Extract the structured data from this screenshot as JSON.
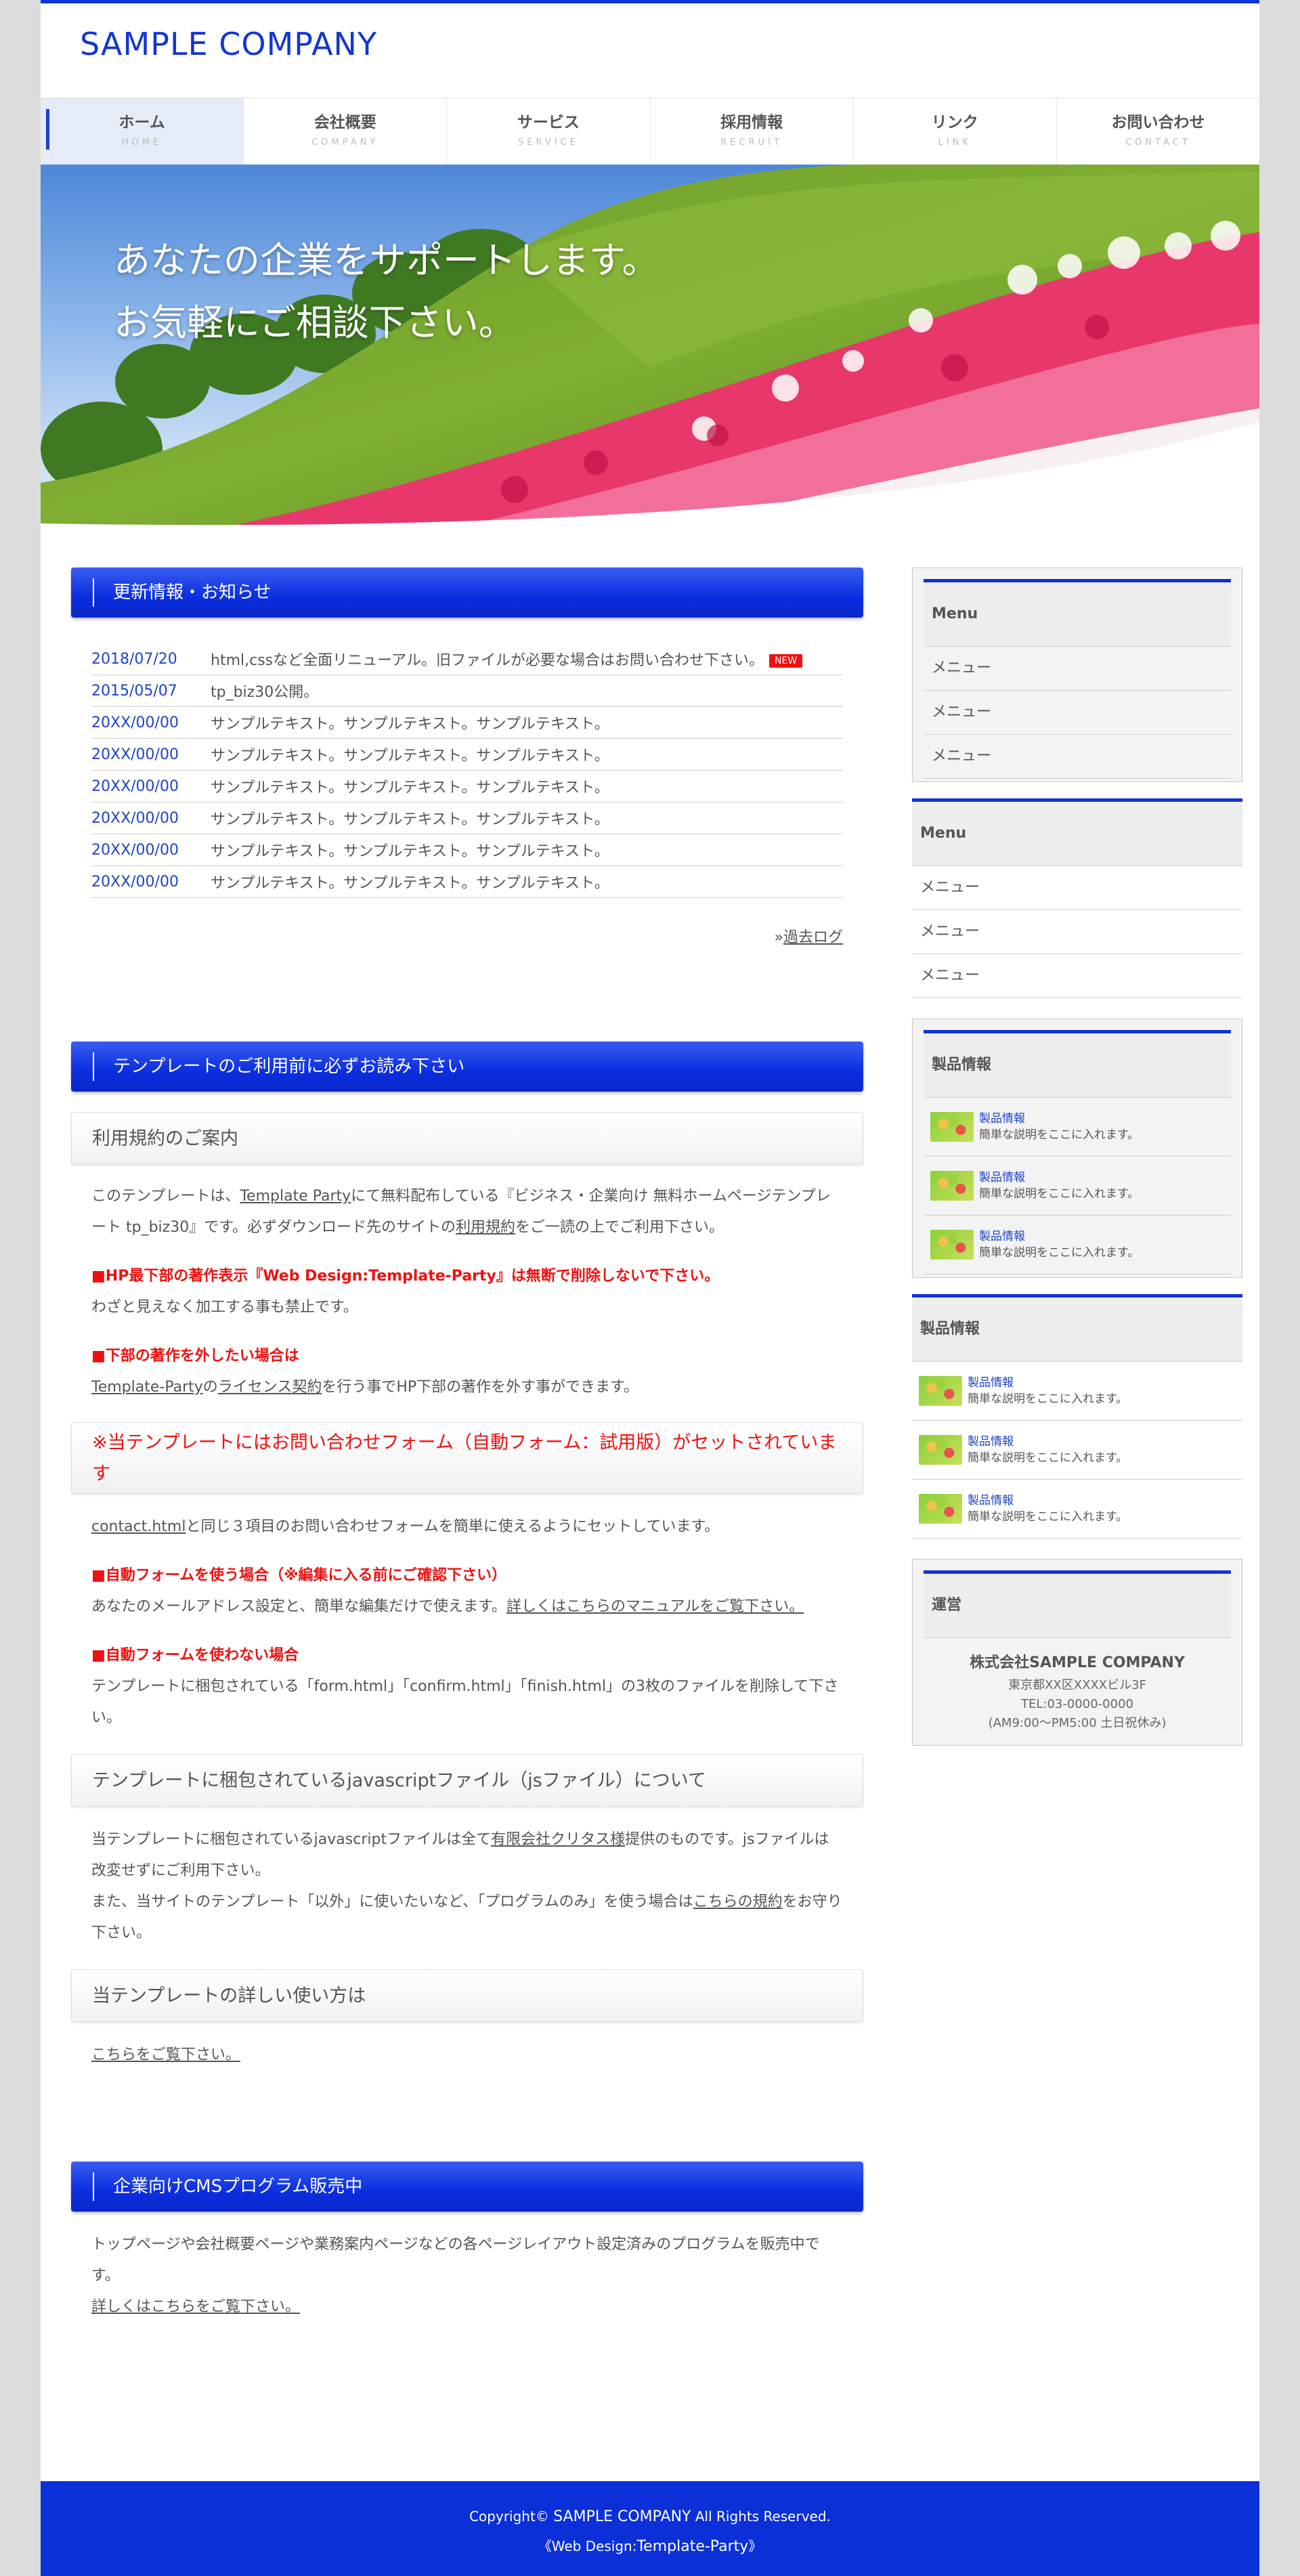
{
  "header": {
    "logo": "SAMPLE COMPANY"
  },
  "nav": [
    {
      "jp": "ホーム",
      "en": "HOME"
    },
    {
      "jp": "会社概要",
      "en": "COMPANY"
    },
    {
      "jp": "サービス",
      "en": "SERVICE"
    },
    {
      "jp": "採用情報",
      "en": "RECRUIT"
    },
    {
      "jp": "リンク",
      "en": "LINK"
    },
    {
      "jp": "お問い合わせ",
      "en": "CONTACT"
    }
  ],
  "hero": {
    "line1": "あなたの企業をサポートします。",
    "line2": "お気軽にご相談下さい。"
  },
  "news": {
    "title": "更新情報・お知らせ",
    "new_badge": "NEW",
    "items": [
      {
        "date": "2018/07/20",
        "text": "html,cssなど全面リニューアル。旧ファイルが必要な場合はお問い合わせ下さい。"
      },
      {
        "date": "2015/05/07",
        "text": "tp_biz30公開。"
      },
      {
        "date": "20XX/00/00",
        "text": "サンプルテキスト。サンプルテキスト。サンプルテキスト。"
      },
      {
        "date": "20XX/00/00",
        "text": "サンプルテキスト。サンプルテキスト。サンプルテキスト。"
      },
      {
        "date": "20XX/00/00",
        "text": "サンプルテキスト。サンプルテキスト。サンプルテキスト。"
      },
      {
        "date": "20XX/00/00",
        "text": "サンプルテキスト。サンプルテキスト。サンプルテキスト。"
      },
      {
        "date": "20XX/00/00",
        "text": "サンプルテキスト。サンプルテキスト。サンプルテキスト。"
      },
      {
        "date": "20XX/00/00",
        "text": "サンプルテキスト。サンプルテキスト。サンプルテキスト。"
      }
    ],
    "archive_prefix": "»",
    "archive_link": "過去ログ"
  },
  "template": {
    "title": "テンプレートのご利用前に必ずお読み下さい",
    "terms_h": "利用規約のご案内",
    "p1_a": "このテンプレートは、",
    "p1_link1": "Template Party",
    "p1_b": "にて無料配布している『ビジネス・企業向け 無料ホームページテンプレート tp_biz30』です。必ずダウンロード先のサイトの",
    "p1_link2": "利用規約",
    "p1_c": "をご一読の上でご利用下さい。",
    "red1": "■HP最下部の著作表示『Web Design:Template-Party』は無断で削除しないで下さい。",
    "p2": "わざと見えなく加工する事も禁止です。",
    "red2": "■下部の著作を外したい場合は",
    "p3_link1": "Template-Party",
    "p3_a": "の",
    "p3_link2": "ライセンス契約",
    "p3_b": "を行う事でHP下部の著作を外す事ができます。",
    "form_h": "※当テンプレートにはお問い合わせフォーム（自動フォーム：試用版）がセットされています",
    "p4_link": "contact.html",
    "p4_a": "と同じ３項目のお問い合わせフォームを簡単に使えるようにセットしています。",
    "red3": "■自動フォームを使う場合（※編集に入る前にご確認下さい）",
    "p5_a": "あなたのメールアドレス設定と、簡単な編集だけで使えます。",
    "p5_link": "詳しくはこちらのマニュアルをご覧下さい。",
    "red4": "■自動フォームを使わない場合",
    "p6": "テンプレートに梱包されている「form.html」「confirm.html」「finish.html」の3枚のファイルを削除して下さい。",
    "js_h": "テンプレートに梱包されているjavascriptファイル（jsファイル）について",
    "p7_a": "当テンプレートに梱包されているjavascriptファイルは全て",
    "p7_link": "有限会社クリタス様",
    "p7_b": "提供のものです。jsファイルは改変せずにご利用下さい。",
    "p8_a": "また、当サイトのテンプレート「以外」に使いたいなど、「プログラムのみ」を使う場合は",
    "p8_link": "こちらの規約",
    "p8_b": "をお守り下さい。",
    "usage_h": "当テンプレートの詳しい使い方は",
    "usage_link": "こちらをご覧下さい。"
  },
  "cms": {
    "title": "企業向けCMSプログラム販売中",
    "p1": "トップページや会社概要ページや業務案内ページなどの各ページレイアウト設定済みのプログラムを販売中です。",
    "link": "詳しくはこちらをご覧下さい。"
  },
  "sidebar": {
    "menu1": {
      "title": "Menu",
      "items": [
        "メニュー",
        "メニュー",
        "メニュー"
      ]
    },
    "menu2": {
      "title": "Menu",
      "items": [
        "メニュー",
        "メニュー",
        "メニュー"
      ]
    },
    "products1": {
      "title": "製品情報",
      "items": [
        {
          "name": "製品情報",
          "desc": "簡単な説明をここに入れます。"
        },
        {
          "name": "製品情報",
          "desc": "簡単な説明をここに入れます。"
        },
        {
          "name": "製品情報",
          "desc": "簡単な説明をここに入れます。"
        }
      ]
    },
    "products2": {
      "title": "製品情報",
      "items": [
        {
          "name": "製品情報",
          "desc": "簡単な説明をここに入れます。"
        },
        {
          "name": "製品情報",
          "desc": "簡単な説明をここに入れます。"
        },
        {
          "name": "製品情報",
          "desc": "簡単な説明をここに入れます。"
        }
      ]
    },
    "company": {
      "title": "運営",
      "name": "株式会社SAMPLE COMPANY",
      "address": "東京都XX区XXXXビル3F",
      "tel": "TEL:03-0000-0000",
      "hours": "(AM9:00〜PM5:00 土日祝休み)"
    }
  },
  "footer": {
    "copy_a": "Copyright© ",
    "copy_name": "SAMPLE COMPANY",
    "copy_b": " All Rights Reserved.",
    "design_a": "《Web Design:",
    "design_name": "Template-Party",
    "design_b": "》"
  },
  "colors": {
    "accent": "#0b30d8",
    "red": "#ee1111",
    "link": "#1e44c8"
  }
}
